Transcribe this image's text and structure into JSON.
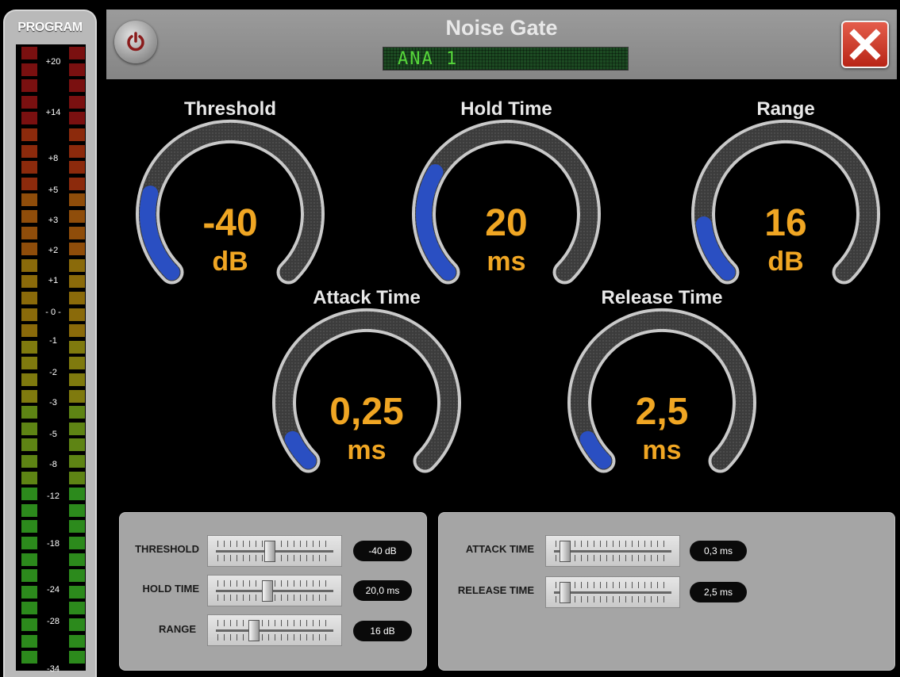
{
  "vu_meter": {
    "title": "PROGRAM",
    "scale": [
      "+20",
      "+14",
      "+8",
      "+5",
      "+3",
      "+2",
      "+1",
      "- 0 -",
      "-1",
      "-2",
      "-3",
      "-5",
      "-8",
      "-12",
      "-18",
      "-24",
      "-28",
      "-34"
    ]
  },
  "header": {
    "title": "Noise Gate",
    "channel": "ANA 1"
  },
  "knobs": [
    {
      "label": "Threshold",
      "value": "-40",
      "unit": "dB",
      "level": 0.22
    },
    {
      "label": "Hold Time",
      "value": "20",
      "unit": "ms",
      "level": 0.28
    },
    {
      "label": "Range",
      "value": "16",
      "unit": "dB",
      "level": 0.14
    },
    {
      "label": "Attack Time",
      "value": "0,25",
      "unit": "ms",
      "level": 0.07
    },
    {
      "label": "Release Time",
      "value": "2,5",
      "unit": "ms",
      "level": 0.07
    }
  ],
  "sliders_left": [
    {
      "label": "THRESHOLD",
      "value": "-40 dB",
      "position": 0.45
    },
    {
      "label": "HOLD TIME",
      "value": "20,0 ms",
      "position": 0.43
    },
    {
      "label": "RANGE",
      "value": "16 dB",
      "position": 0.3
    }
  ],
  "sliders_right": [
    {
      "label": "ATTACK TIME",
      "value": "0,3 ms",
      "position": 0.05
    },
    {
      "label": "RELEASE TIME",
      "value": "2,5 ms",
      "position": 0.05
    }
  ],
  "colors": {
    "accent_value": "#f0a623",
    "knob_fill": "#2a4fc2",
    "header": "#909090"
  }
}
